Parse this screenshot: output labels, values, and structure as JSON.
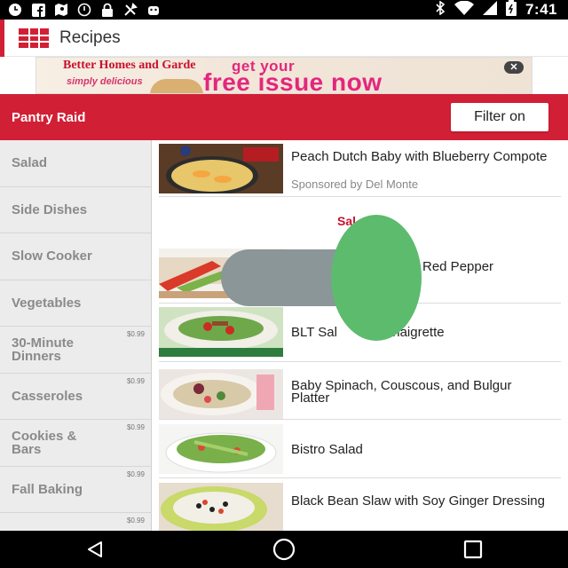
{
  "status_bar": {
    "time": "7:41",
    "left_icons": [
      "clock-icon",
      "facebook-icon",
      "map-icon",
      "block-icon",
      "lock-icon",
      "tools-icon",
      "android-icon"
    ],
    "right_icons": [
      "bluetooth-icon",
      "wifi-icon",
      "cell-signal-icon",
      "battery-icon"
    ]
  },
  "app_bar": {
    "title": "Recipes",
    "logo_icon": "bhg-plaid-icon"
  },
  "ad": {
    "brand": "Better Homes and Gardens",
    "magazine": "simply delicious",
    "headline_top": "get your",
    "headline_main": "free issue now",
    "close_label": "✕"
  },
  "red_bar": {
    "title": "Pantry Raid",
    "filter_button": "Filter on",
    "color": "#d11f35"
  },
  "sidebar": {
    "categories": [
      {
        "label": "Salad",
        "price": ""
      },
      {
        "label": "Side Dishes",
        "price": ""
      },
      {
        "label": "Slow Cooker",
        "price": ""
      },
      {
        "label": "Vegetables",
        "price": ""
      },
      {
        "label": "30-Minute Dinners",
        "price": "$0.99"
      },
      {
        "label": "Casseroles",
        "price": "$0.99"
      },
      {
        "label": "Cookies & Bars",
        "price": "$0.99"
      },
      {
        "label": "Fall Baking",
        "price": "$0.99"
      },
      {
        "label": "",
        "price": "$0.99"
      }
    ]
  },
  "recipes": {
    "sponsored": {
      "title": "Peach Dutch Baby with Blueberry Compote",
      "sponsor": "Sponsored by Del Monte"
    },
    "section_label": "Sal",
    "items": [
      {
        "title": "Red Pepper"
      },
      {
        "title": "BLT Sal       ith Vinaigrette"
      },
      {
        "title": "Baby Spinach, Couscous, and Bulgur Platter"
      },
      {
        "title": "Bistro Salad"
      },
      {
        "title": "Black Bean Slaw with Soy Ginger Dressing"
      }
    ]
  },
  "nav_bar": {
    "buttons": [
      "back-icon",
      "home-icon",
      "recents-icon"
    ]
  }
}
